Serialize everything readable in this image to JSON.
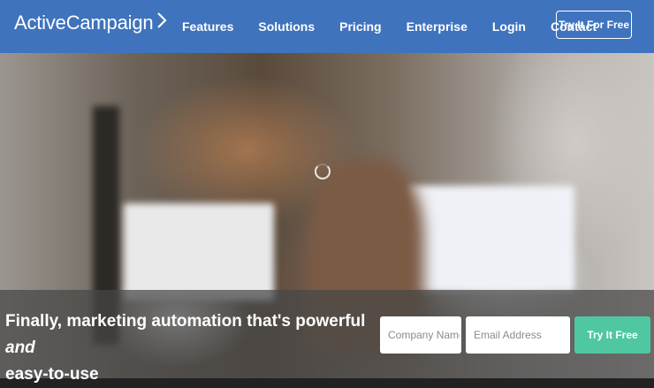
{
  "header": {
    "logo": {
      "text": "ActiveCampaign",
      "icon": "chevron-right-icon"
    },
    "nav": [
      {
        "label": "Features"
      },
      {
        "label": "Solutions"
      },
      {
        "label": "Pricing"
      },
      {
        "label": "Enterprise"
      },
      {
        "label": "Login"
      },
      {
        "label": "Contact"
      }
    ],
    "cta_label": "Try It For Free"
  },
  "hero": {
    "headline_part1": "Finally, marketing automation that's powerful ",
    "headline_emphasis": "and",
    "headline_part2": "easy-to-use",
    "form": {
      "company_placeholder": "Company Name",
      "email_placeholder": "Email Address",
      "submit_label": "Try It Free"
    },
    "loading_icon": "spinner-icon"
  },
  "colors": {
    "header_bg": "#3f73bd",
    "submit_bg": "#4fc7a2",
    "bar_bg": "rgba(70,70,70,0.72)"
  }
}
